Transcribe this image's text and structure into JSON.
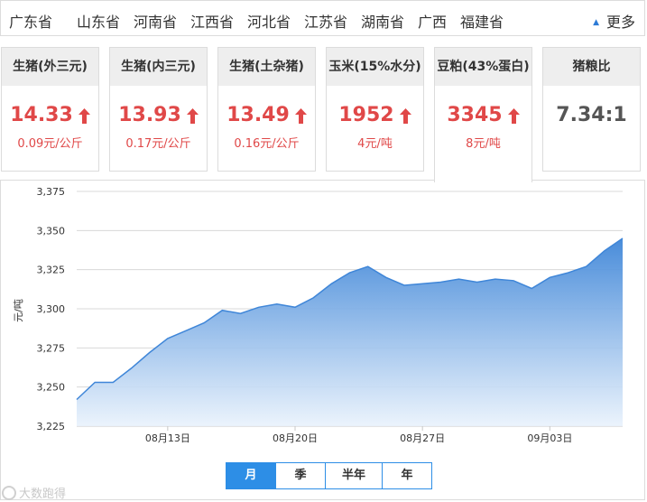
{
  "provinces": [
    "广东省",
    "山东省",
    "河南省",
    "江西省",
    "河北省",
    "江苏省",
    "湖南省",
    "广西",
    "福建省"
  ],
  "more_label": "更多",
  "cards": [
    {
      "title": "生猪(外三元)",
      "price": "14.33",
      "change": "0.09元/公斤",
      "trend": "up"
    },
    {
      "title": "生猪(内三元)",
      "price": "13.93",
      "change": "0.17元/公斤",
      "trend": "up"
    },
    {
      "title": "生猪(土杂猪)",
      "price": "13.49",
      "change": "0.16元/公斤",
      "trend": "up"
    },
    {
      "title": "玉米(15%水分)",
      "price": "1952",
      "change": "4元/吨",
      "trend": "up"
    },
    {
      "title": "豆粕(43%蛋白)",
      "price": "3345",
      "change": "8元/吨",
      "trend": "up"
    }
  ],
  "ratio_card": {
    "title": "猪粮比",
    "value": "7.34:1"
  },
  "colors": {
    "accent": "#2d8ee6",
    "up": "#e04848",
    "line": "#3f86d8"
  },
  "chart_data": {
    "type": "area",
    "ylabel": "元/吨",
    "ylim": [
      3225,
      3375
    ],
    "yticks": [
      3225,
      3250,
      3275,
      3300,
      3325,
      3350,
      3375
    ],
    "ytick_labels": [
      "3,225",
      "3,250",
      "3,275",
      "3,300",
      "3,325",
      "3,350",
      "3,375"
    ],
    "xtick_labels": [
      {
        "date": "08-13",
        "label": "08月13日"
      },
      {
        "date": "08-20",
        "label": "08月20日"
      },
      {
        "date": "08-27",
        "label": "08月27日"
      },
      {
        "date": "09-03",
        "label": "09月03日"
      }
    ],
    "grid": true,
    "points": [
      {
        "date": "08-08",
        "value": 3242
      },
      {
        "date": "08-09",
        "value": 3253
      },
      {
        "date": "08-10",
        "value": 3253
      },
      {
        "date": "08-11",
        "value": 3262
      },
      {
        "date": "08-12",
        "value": 3272
      },
      {
        "date": "08-13",
        "value": 3281
      },
      {
        "date": "08-14",
        "value": 3286
      },
      {
        "date": "08-15",
        "value": 3291
      },
      {
        "date": "08-16",
        "value": 3299
      },
      {
        "date": "08-17",
        "value": 3297
      },
      {
        "date": "08-18",
        "value": 3301
      },
      {
        "date": "08-19",
        "value": 3303
      },
      {
        "date": "08-20",
        "value": 3301
      },
      {
        "date": "08-21",
        "value": 3307
      },
      {
        "date": "08-22",
        "value": 3316
      },
      {
        "date": "08-23",
        "value": 3323
      },
      {
        "date": "08-24",
        "value": 3327
      },
      {
        "date": "08-25",
        "value": 3320
      },
      {
        "date": "08-26",
        "value": 3315
      },
      {
        "date": "08-27",
        "value": 3316
      },
      {
        "date": "08-28",
        "value": 3317
      },
      {
        "date": "08-29",
        "value": 3319
      },
      {
        "date": "08-30",
        "value": 3317
      },
      {
        "date": "08-31",
        "value": 3319
      },
      {
        "date": "09-01",
        "value": 3318
      },
      {
        "date": "09-02",
        "value": 3313
      },
      {
        "date": "09-03",
        "value": 3320
      },
      {
        "date": "09-04",
        "value": 3323
      },
      {
        "date": "09-05",
        "value": 3327
      },
      {
        "date": "09-06",
        "value": 3337
      },
      {
        "date": "09-07",
        "value": 3345
      }
    ]
  },
  "tabs": [
    {
      "label": "月",
      "active": true
    },
    {
      "label": "季",
      "active": false
    },
    {
      "label": "半年",
      "active": false
    },
    {
      "label": "年",
      "active": false
    }
  ],
  "watermark": "大数跑得"
}
